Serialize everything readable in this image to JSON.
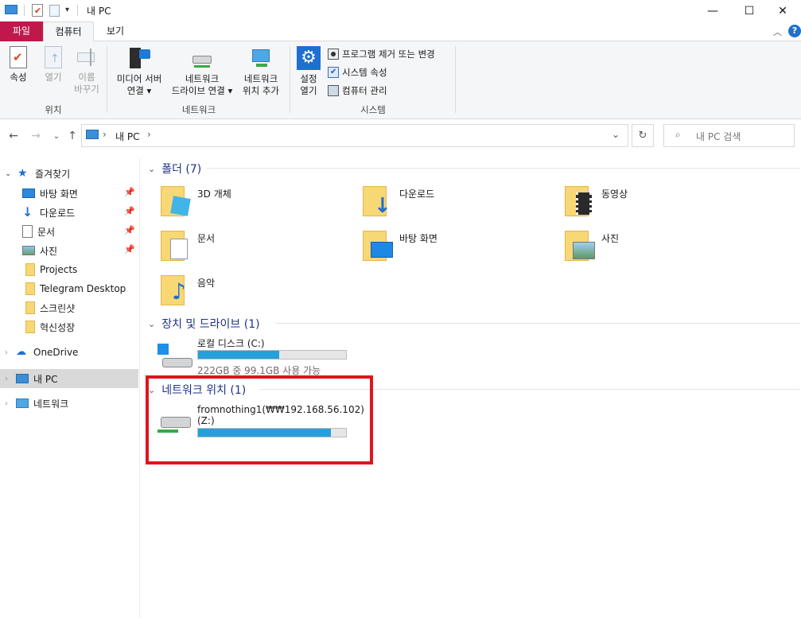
{
  "window": {
    "title": "내 PC",
    "minimize": "—",
    "maximize": "☐",
    "close": "✕"
  },
  "ribbon_tabs": [
    "파일",
    "컴퓨터",
    "보기"
  ],
  "ribbon": {
    "groups": {
      "location": "위치",
      "network": "네트워크",
      "system": "시스템"
    },
    "buttons": {
      "properties": "속성",
      "open": "열기",
      "rename_1": "이름",
      "rename_2": "바꾸기",
      "media_1": "미디어 서버",
      "media_2": "연결 ▾",
      "map_1": "네트워크",
      "map_2": "드라이브 연결 ▾",
      "addloc_1": "네트워크",
      "addloc_2": "위치 추가",
      "settings_1": "설정",
      "settings_2": "열기"
    },
    "system_cmds": [
      "프로그램 제거 또는 변경",
      "시스템 속성",
      "컴퓨터 관리"
    ]
  },
  "address": {
    "path_root": "›",
    "path": "내 PC",
    "path_sep": "›",
    "search_placeholder": "내 PC 검색"
  },
  "sidebar": {
    "quick_access": "즐겨찾기",
    "items": [
      "바탕 화면",
      "다운로드",
      "문서",
      "사진",
      "Projects",
      "Telegram Desktop",
      "스크린샷",
      "혁신성장"
    ],
    "onedrive": "OneDrive",
    "this_pc": "내 PC",
    "network": "네트워크"
  },
  "sections": {
    "folders": "폴더 (7)",
    "devices": "장치 및 드라이브 (1)",
    "netloc": "네트워크 위치 (1)"
  },
  "folders": [
    "3D 개체",
    "다운로드",
    "동영상",
    "문서",
    "바탕 화면",
    "사진",
    "음악"
  ],
  "drives": [
    {
      "name": "로컬 디스크 (C:)",
      "info": "222GB 중 99.1GB 사용 가능",
      "used_fraction": 0.55
    }
  ],
  "network_locations": [
    {
      "name": "fromnothing1(₩₩192.168.56.102)",
      "letter": "(Z:)",
      "used_fraction": 0.9
    }
  ],
  "colors": {
    "file_tab": "#c1184c",
    "accent_text": "#1e3287",
    "bar_fill": "#26a0da",
    "highlight_border": "#e0141e",
    "selected_bg": "#cce4f7"
  }
}
